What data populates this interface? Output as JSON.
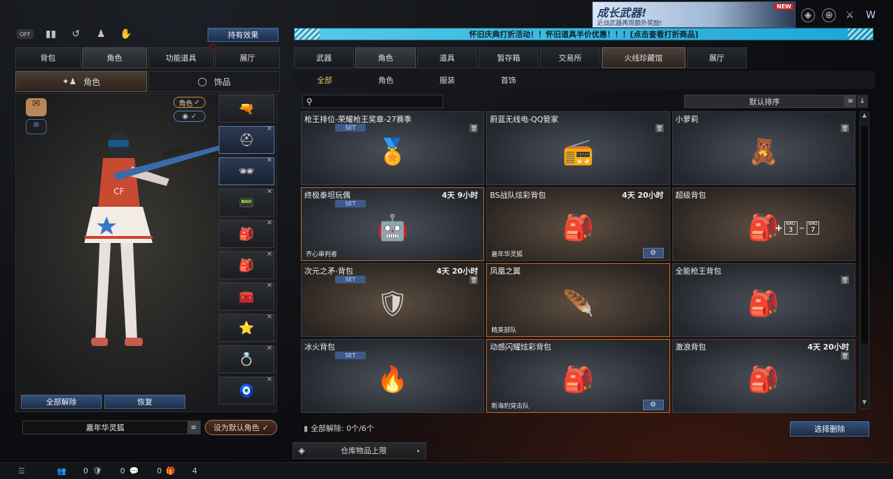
{
  "banner": {
    "title": "成长武器!",
    "subtitle": "近战武器再现额外奖励!",
    "new_badge": "NEW"
  },
  "effects_button": "持有效果",
  "top_icons": [
    "off-toggle-icon",
    "ranking-icon",
    "history-icon",
    "character-icon",
    "pet-icon"
  ],
  "left_tabs": [
    "背包",
    "角色",
    "功能道具",
    "展厅"
  ],
  "left_subtabs": [
    "角色",
    "饰品"
  ],
  "char_toggle": "角色",
  "slot_icons": [
    "🔫",
    "⛑",
    "🕶",
    "📟",
    "🎒",
    "🎒",
    "🧰",
    "⭐",
    "💍",
    "🧿"
  ],
  "release_all": "全部解除",
  "restore": "恢复",
  "character_name": "嘉年华灵狐",
  "set_default": "设为默认角色",
  "ticker": "怀旧庆典打折活动！！怀旧道具半价优惠！！！[点击查看打折商品]",
  "right_tabs": [
    "武器",
    "角色",
    "道具",
    "暂存箱",
    "交易所",
    "火线珍藏馆",
    "展厅"
  ],
  "right_subtabs": [
    "全部",
    "角色",
    "服装",
    "首饰"
  ],
  "search": {
    "placeholder": ""
  },
  "sort_label": "默认排序",
  "items": [
    {
      "name": "枪王排位-荣耀枪王奖章-27赛季",
      "time": "",
      "set": "SET",
      "trash": true,
      "sub": "",
      "gear": false,
      "glyph": "🏅",
      "style": ""
    },
    {
      "name": "蔚蓝无线电-QQ管家",
      "time": "",
      "set": "",
      "trash": true,
      "sub": "",
      "gear": false,
      "glyph": "📻",
      "style": ""
    },
    {
      "name": "小萝莉",
      "time": "",
      "set": "",
      "trash": true,
      "sub": "",
      "gear": false,
      "glyph": "🧸",
      "style": ""
    },
    {
      "name": "终极泰坦玩偶",
      "time": "4天 9小时",
      "set": "SET",
      "trash": false,
      "sub": "齐心审判者",
      "gear": false,
      "glyph": "🤖",
      "style": "orange"
    },
    {
      "name": "BS战队炫彩背包",
      "time": "4天 20小时",
      "set": "",
      "trash": false,
      "sub": "嘉年华灵狐",
      "gear": true,
      "glyph": "🎒",
      "style": "warm"
    },
    {
      "name": "超级背包",
      "time": "",
      "set": "",
      "trash": false,
      "sub": "",
      "gear": false,
      "glyph": "🎒",
      "style": "warm",
      "extra": [
        "BAG",
        "3",
        "~",
        "BAG",
        "7"
      ]
    },
    {
      "name": "次元之矛-背包",
      "time": "4天 20小时",
      "set": "SET",
      "trash": true,
      "sub": "",
      "gear": false,
      "glyph": "🛡",
      "style": "warm"
    },
    {
      "name": "凤凰之翼",
      "time": "",
      "set": "",
      "trash": false,
      "sub": "精英部队",
      "gear": false,
      "glyph": "🪶",
      "style": "warm orange"
    },
    {
      "name": "全能枪王背包",
      "time": "",
      "set": "",
      "trash": true,
      "sub": "",
      "gear": false,
      "glyph": "🎒",
      "style": ""
    },
    {
      "name": "冰火背包",
      "time": "",
      "set": "SET",
      "trash": false,
      "sub": "",
      "gear": false,
      "glyph": "🔥",
      "style": ""
    },
    {
      "name": "动感闪耀炫彩背包",
      "time": "",
      "set": "",
      "trash": false,
      "sub": "新海豹突击队",
      "gear": true,
      "glyph": "🎒",
      "style": "orange"
    },
    {
      "name": "激浪背包",
      "time": "4天 20小时",
      "set": "",
      "trash": true,
      "sub": "",
      "gear": false,
      "glyph": "🎒",
      "style": ""
    }
  ],
  "release_status": "全部解除: 0个/6个",
  "select_delete": "选择删除",
  "warehouse_limit": "仓库物品上限",
  "bottom": {
    "count1": "0",
    "count2": "0",
    "count3": "0",
    "count4": "4"
  }
}
